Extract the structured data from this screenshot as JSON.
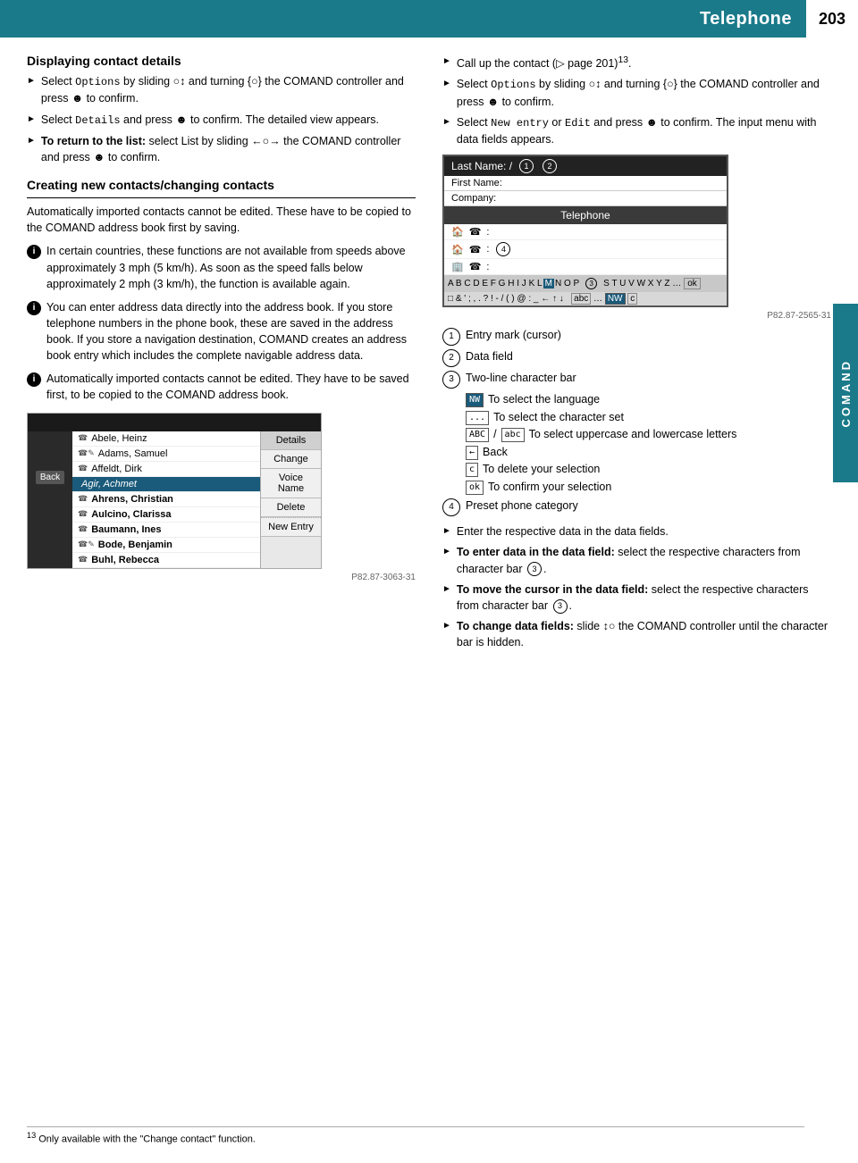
{
  "header": {
    "title": "Telephone",
    "page_number": "203",
    "section": "COMAND"
  },
  "left_column": {
    "section1_title": "Displaying contact details",
    "section1_bullets": [
      {
        "text": "Select Options by sliding ⊙↕ and turning {⊙} the COMAND controller and press ⊛ to confirm."
      },
      {
        "text": "Select Details and press ⊛ to confirm. The detailed view appears."
      },
      {
        "text": "To return to the list: select List by sliding ←⊙→ the COMAND controller and press ⊛ to confirm."
      }
    ],
    "section2_title": "Creating new contacts/changing contacts",
    "info_block1": "In certain countries, these functions are not available from speeds above approximately 3 mph (5 km/h). As soon as the speed falls below approximately 2 mph (3 km/h), the function is available again.",
    "info_block2": "You can enter address data directly into the address book. If you store telephone numbers in the phone book, these are saved in the address book. If you store a navigation destination, COMAND creates an address book entry which includes the complete navigable address data.",
    "info_block3": "Automatically imported contacts cannot be edited. They have to be saved first, to be copied to the COMAND address book.",
    "contact_list": {
      "items": [
        {
          "name": "Abele, Heinz",
          "icon": "☎",
          "highlighted": false
        },
        {
          "name": "Adams, Samuel",
          "icon": "☎✎",
          "highlighted": false
        },
        {
          "name": "Affeldt, Dirk",
          "icon": "☎",
          "highlighted": false
        },
        {
          "name": "Agir, Achmet",
          "icon": "",
          "highlighted": true
        },
        {
          "name": "Ahrens, Christian",
          "icon": "☎",
          "highlighted": false,
          "bold": true
        },
        {
          "name": "Aulcino, Clarissa",
          "icon": "☎",
          "highlighted": false,
          "bold": true
        },
        {
          "name": "Baumann, Ines",
          "icon": "☎",
          "highlighted": false,
          "bold": true
        },
        {
          "name": "Bode, Benjamin",
          "icon": "☎✎",
          "highlighted": false,
          "bold": true
        },
        {
          "name": "Buhl, Rebecca",
          "icon": "☎",
          "highlighted": false,
          "bold": true
        }
      ],
      "right_panel": [
        "Details",
        "Change",
        "Voice Name",
        "Delete",
        "···",
        "New Entry"
      ],
      "caption": "P82.87-3063-31"
    }
  },
  "right_column": {
    "bullets": [
      {
        "text": "Call up the contact (▷ page 201)¹³."
      },
      {
        "text": "Select Options by sliding ⊙↕ and turning {⊙} the COMAND controller and press ⊛ to confirm."
      },
      {
        "text": "Select New entry or Edit and press ⊛ to confirm. The input menu with data fields appears."
      }
    ],
    "telephone_screen": {
      "last_name_label": "Last Name: /",
      "first_name_label": "First Name:",
      "company_label": "Company:",
      "telephone_label": "Telephone",
      "phone_rows": [
        {
          "icon": "🏠",
          "label": "⊙:"
        },
        {
          "icon": "🏠",
          "label": "⊙:",
          "num": "4"
        },
        {
          "icon": "🏢",
          "label": "⊙:"
        }
      ],
      "char_bar": "A B C D E F G H I J K L M N O P   S T U V W X Y Z ...",
      "char_bar2": "□ & ' ; , . ? ! - / ( ) @ : _ ← ↑ ↓",
      "caption": "P82.87-2565-31",
      "circle1": "1",
      "circle2": "2",
      "circle3": "3"
    },
    "legend": [
      {
        "num": "1",
        "text": "Entry mark (cursor)"
      },
      {
        "num": "2",
        "text": "Data field"
      },
      {
        "num": "3",
        "text": "Two-line character bar"
      }
    ],
    "sub_legend": [
      {
        "icon": "NW",
        "text": "To select the language"
      },
      {
        "icon": "...",
        "text": "To select the character set"
      },
      {
        "icon": "ABC/abc",
        "text": "To select uppercase and lowercase letters"
      },
      {
        "icon": "↵",
        "text": "Back"
      },
      {
        "icon": "c",
        "text": "To delete your selection"
      },
      {
        "icon": "ok",
        "text": "To confirm your selection"
      }
    ],
    "legend4": {
      "num": "4",
      "text": "Preset phone category"
    },
    "more_bullets": [
      {
        "text": "Enter the respective data in the data fields."
      },
      {
        "text": "To enter data in the data field: select the respective characters from character bar ③."
      },
      {
        "text": "To move the cursor in the data field: select the respective characters from character bar ③."
      },
      {
        "text": "To change data fields:  slide ↕⊙ the COMAND controller until the character bar is hidden."
      }
    ]
  },
  "footnote": {
    "number": "13",
    "text": "Only available with the \"Change contact\" function."
  }
}
